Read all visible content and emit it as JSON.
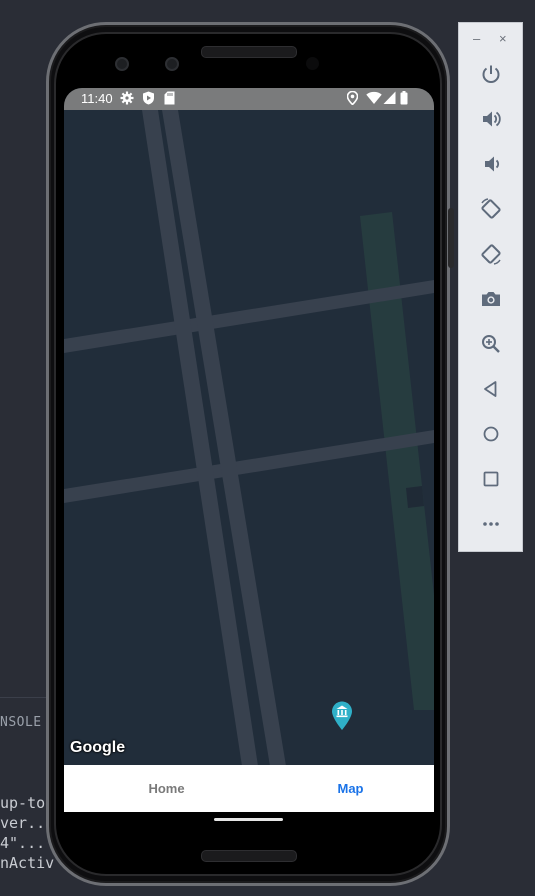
{
  "console": {
    "tab_label": "NSOLE",
    "lines": [
      "up-to",
      "ver..",
      "4\"...",
      "nActiv"
    ]
  },
  "statusbar": {
    "time": "11:40",
    "icons": [
      "settings-icon",
      "shield-icon",
      "sd-card-icon",
      "location-icon",
      "wifi-icon",
      "signal-icon",
      "battery-icon"
    ]
  },
  "map": {
    "attribution": "Google",
    "marker": "museum-marker-icon",
    "colors": {
      "land": "#212d3a",
      "road": "#38414e",
      "park": "#263c3f",
      "marker": "#2fb0c8"
    }
  },
  "tabs": [
    {
      "label": "Home",
      "active": false,
      "color": "#7a7a7a"
    },
    {
      "label": "Map",
      "active": true,
      "color": "#1a73e8"
    }
  ],
  "emulator": {
    "window_controls": [
      "minimize-icon",
      "close-icon"
    ],
    "buttons": [
      "power-icon",
      "volume-up-icon",
      "volume-down-icon",
      "rotate-left-icon",
      "rotate-right-icon",
      "camera-icon",
      "zoom-icon",
      "back-icon",
      "home-icon",
      "overview-icon",
      "more-icon"
    ],
    "minimize_glyph": "–",
    "close_glyph": "×"
  }
}
